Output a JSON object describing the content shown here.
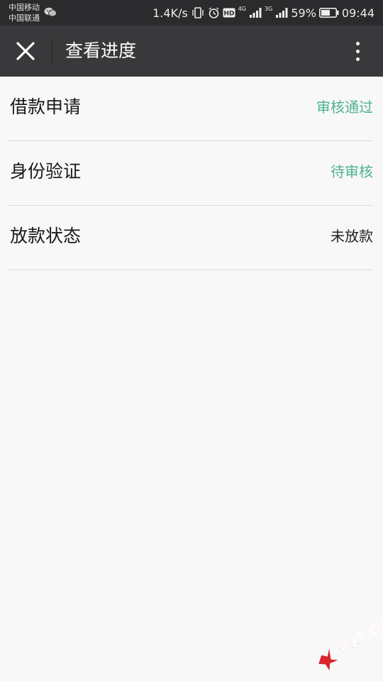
{
  "statusbar": {
    "carrier1": "中国移动",
    "carrier2": "中国联通",
    "speed": "1.4K/s",
    "sig1_label": "4G",
    "sig2_label": "3G",
    "battery": "59%",
    "time": "09:44"
  },
  "titlebar": {
    "title": "查看进度"
  },
  "list": [
    {
      "label": "借款申请",
      "status": "审核通过"
    },
    {
      "label": "身份验证",
      "status": "待审核"
    },
    {
      "label": "放款状态",
      "status": "未放款"
    }
  ],
  "watermark": {
    "text": "卡农社区"
  },
  "colors": {
    "status_bar_bg": "#2b2b2d",
    "title_bar_bg": "#39393b",
    "page_bg": "#f8f8f8",
    "status_green": "#4fb28e",
    "watermark_red": "#d8262b"
  },
  "icons": {
    "close": "close-icon",
    "more": "more-vertical-icon",
    "wechat": "wechat-icon",
    "vibrate": "vibrate-icon",
    "alarm": "alarm-icon",
    "hd": "hd-icon",
    "signal": "signal-icon",
    "battery": "battery-icon"
  }
}
